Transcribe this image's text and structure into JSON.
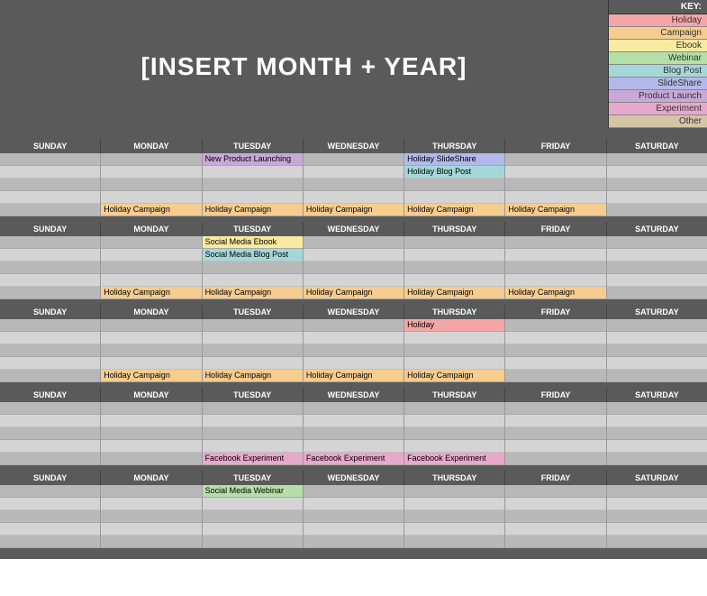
{
  "title": "[INSERT MONTH + YEAR]",
  "key": {
    "header": "KEY:",
    "items": [
      {
        "label": "Holiday",
        "color": "#f4a6a6"
      },
      {
        "label": "Campaign",
        "color": "#f6cc8f"
      },
      {
        "label": "Ebook",
        "color": "#f8eaa0"
      },
      {
        "label": "Webinar",
        "color": "#b4e0a8"
      },
      {
        "label": "Blog Post",
        "color": "#a4d8d8"
      },
      {
        "label": "SlideShare",
        "color": "#b3b9ea"
      },
      {
        "label": "Product Launch",
        "color": "#c8a8d6"
      },
      {
        "label": "Experiment",
        "color": "#e8a8cc"
      },
      {
        "label": "Other",
        "color": "#d4c4a8"
      }
    ]
  },
  "days": [
    "SUNDAY",
    "MONDAY",
    "TUESDAY",
    "WEDNESDAY",
    "THURSDAY",
    "FRIDAY",
    "SATURDAY"
  ],
  "colors": {
    "holiday": "#f4a6a6",
    "campaign": "#f6cc8f",
    "ebook": "#f8eaa0",
    "webinar": "#b4e0a8",
    "blogpost": "#a4d8d8",
    "slideshare": "#b3b9ea",
    "productlaunch": "#c8a8d6",
    "experiment": "#e8a8cc"
  },
  "weeks": [
    {
      "cells": [
        [
          null,
          null,
          null,
          null,
          null
        ],
        [
          null,
          null,
          null,
          null,
          {
            "text": "Holiday Campaign",
            "color": "campaign"
          }
        ],
        [
          {
            "text": "New Product Launching",
            "color": "productlaunch"
          },
          null,
          null,
          null,
          {
            "text": "Holiday Campaign",
            "color": "campaign"
          }
        ],
        [
          null,
          null,
          null,
          null,
          {
            "text": "Holiday Campaign",
            "color": "campaign"
          }
        ],
        [
          {
            "text": "Holiday SlideShare",
            "color": "slideshare"
          },
          {
            "text": "Holiday Blog Post",
            "color": "blogpost"
          },
          null,
          null,
          {
            "text": "Holiday Campaign",
            "color": "campaign"
          }
        ],
        [
          null,
          null,
          null,
          null,
          {
            "text": "Holiday Campaign",
            "color": "campaign"
          }
        ],
        [
          null,
          null,
          null,
          null,
          null
        ]
      ]
    },
    {
      "cells": [
        [
          null,
          null,
          null,
          null,
          null
        ],
        [
          null,
          null,
          null,
          null,
          {
            "text": "Holiday Campaign",
            "color": "campaign"
          }
        ],
        [
          {
            "text": "Social Media Ebook",
            "color": "ebook"
          },
          {
            "text": "Social Media Blog Post",
            "color": "blogpost"
          },
          null,
          null,
          {
            "text": "Holiday Campaign",
            "color": "campaign"
          }
        ],
        [
          null,
          null,
          null,
          null,
          {
            "text": "Holiday Campaign",
            "color": "campaign"
          }
        ],
        [
          null,
          null,
          null,
          null,
          {
            "text": "Holiday Campaign",
            "color": "campaign"
          }
        ],
        [
          null,
          null,
          null,
          null,
          {
            "text": "Holiday Campaign",
            "color": "campaign"
          }
        ],
        [
          null,
          null,
          null,
          null,
          null
        ]
      ]
    },
    {
      "cells": [
        [
          null,
          null,
          null,
          null,
          null
        ],
        [
          null,
          null,
          null,
          null,
          {
            "text": "Holiday Campaign",
            "color": "campaign"
          }
        ],
        [
          null,
          null,
          null,
          null,
          {
            "text": "Holiday Campaign",
            "color": "campaign"
          }
        ],
        [
          null,
          null,
          null,
          null,
          {
            "text": "Holiday Campaign",
            "color": "campaign"
          }
        ],
        [
          {
            "text": "Holiday",
            "color": "holiday"
          },
          null,
          null,
          null,
          {
            "text": "Holiday Campaign",
            "color": "campaign"
          }
        ],
        [
          null,
          null,
          null,
          null,
          null
        ],
        [
          null,
          null,
          null,
          null,
          null
        ]
      ]
    },
    {
      "cells": [
        [
          null,
          null,
          null,
          null,
          null
        ],
        [
          null,
          null,
          null,
          null,
          null
        ],
        [
          null,
          null,
          null,
          null,
          {
            "text": "Facebook Experiment",
            "color": "experiment"
          }
        ],
        [
          null,
          null,
          null,
          null,
          {
            "text": "Facebook Experiment",
            "color": "experiment"
          }
        ],
        [
          null,
          null,
          null,
          null,
          {
            "text": "Facebook Experiment",
            "color": "experiment"
          }
        ],
        [
          null,
          null,
          null,
          null,
          null
        ],
        [
          null,
          null,
          null,
          null,
          null
        ]
      ]
    },
    {
      "cells": [
        [
          null,
          null,
          null,
          null,
          null
        ],
        [
          null,
          null,
          null,
          null,
          null
        ],
        [
          {
            "text": "Social Media Webinar",
            "color": "webinar"
          },
          null,
          null,
          null,
          null
        ],
        [
          null,
          null,
          null,
          null,
          null
        ],
        [
          null,
          null,
          null,
          null,
          null
        ],
        [
          null,
          null,
          null,
          null,
          null
        ],
        [
          null,
          null,
          null,
          null,
          null
        ]
      ]
    }
  ]
}
